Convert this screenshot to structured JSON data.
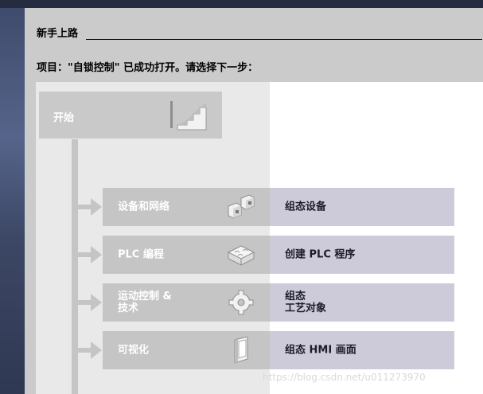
{
  "header": {
    "title": "新手上路",
    "subtitle": "项目：\"自锁控制\" 已成功打开。请选择下一步："
  },
  "start": {
    "label": "开始",
    "icon": "stairs-icon"
  },
  "rows": [
    {
      "left_label": "设备和网络",
      "left_icon": "devices-network-icon",
      "right_label": "组态设备"
    },
    {
      "left_label": "PLC 编程",
      "left_icon": "puzzle-icon",
      "right_label": "创建 PLC 程序"
    },
    {
      "left_label": "运动控制 &\n技术",
      "left_icon": "gear-icon",
      "right_label": "组态\n工艺对象"
    },
    {
      "left_label": "可视化",
      "left_icon": "hmi-panel-icon",
      "right_label": "组态 HMI 画面"
    }
  ],
  "watermark": "https://blog.csdn.net/u011273970"
}
